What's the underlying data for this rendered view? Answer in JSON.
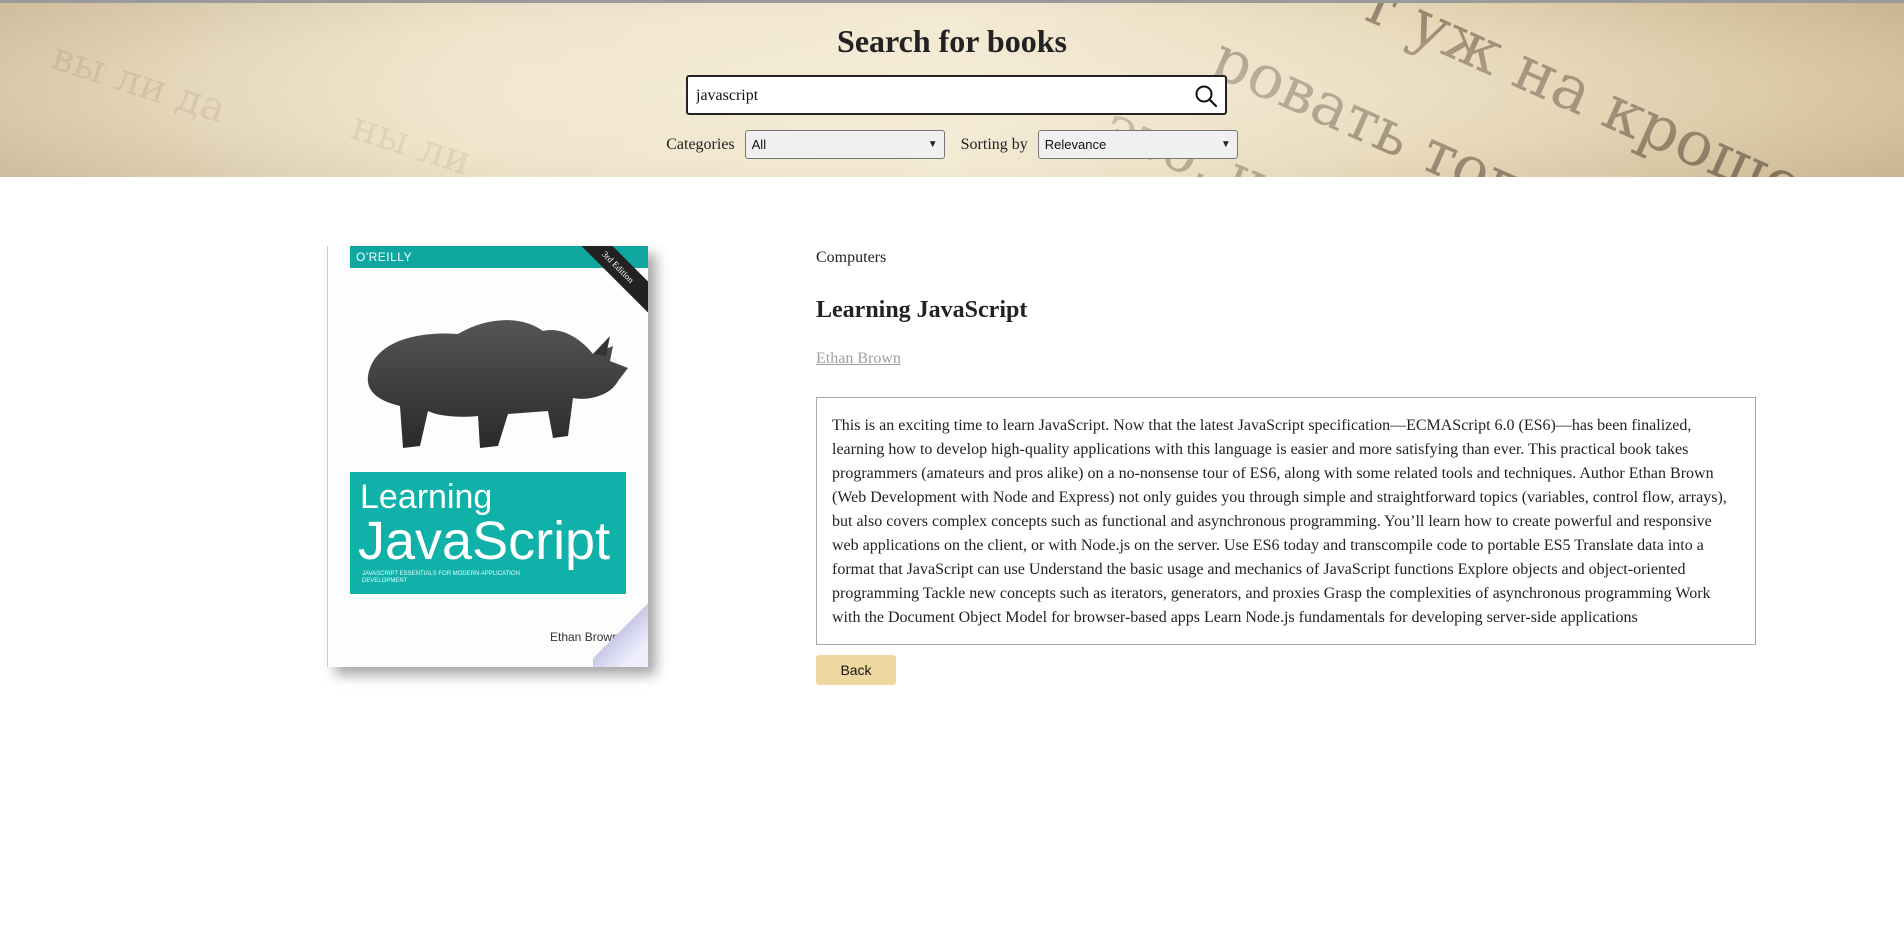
{
  "header": {
    "title": "Search for books",
    "search": {
      "value": "javascript",
      "icon": "search-icon"
    },
    "categories_label": "Categories",
    "categories_selected": "All",
    "sorting_label": "Sorting by",
    "sorting_selected": "Relevance"
  },
  "book": {
    "category": "Computers",
    "title": "Learning JavaScript",
    "author": "Ethan Brown",
    "description": "This is an exciting time to learn JavaScript. Now that the latest JavaScript specification—ECMAScript 6.0 (ES6)—has been finalized, learning how to develop high-quality applications with this language is easier and more satisfying than ever. This practical book takes programmers (amateurs and pros alike) on a no-nonsense tour of ES6, along with some related tools and techniques. Author Ethan Brown (Web Development with Node and Express) not only guides you through simple and straightforward topics (variables, control flow, arrays), but also covers complex concepts such as functional and asynchronous programming. You’ll learn how to create powerful and responsive web applications on the client, or with Node.js on the server. Use ES6 today and transcompile code to portable ES5 Translate data into a format that JavaScript can use Understand the basic usage and mechanics of JavaScript functions Explore objects and object-oriented programming Tackle new concepts such as iterators, generators, and proxies Grasp the complexities of asynchronous programming Work with the Document Object Model for browser-based apps Learn Node.js fundamentals for developing server-side applications",
    "cover": {
      "publisher": "O'REILLY",
      "edition": "3rd Edition",
      "title_line1": "Learning",
      "title_line2": "JavaScript",
      "subtitle": "JAVASCRIPT ESSENTIALS FOR MODERN APPLICATION DEVELOPMENT",
      "author": "Ethan Brown"
    }
  },
  "actions": {
    "back_label": "Back"
  },
  "colors": {
    "back_button": "#efd8a0",
    "author_link": "#a0a0a0",
    "cover_teal": "#10b1a9"
  }
}
